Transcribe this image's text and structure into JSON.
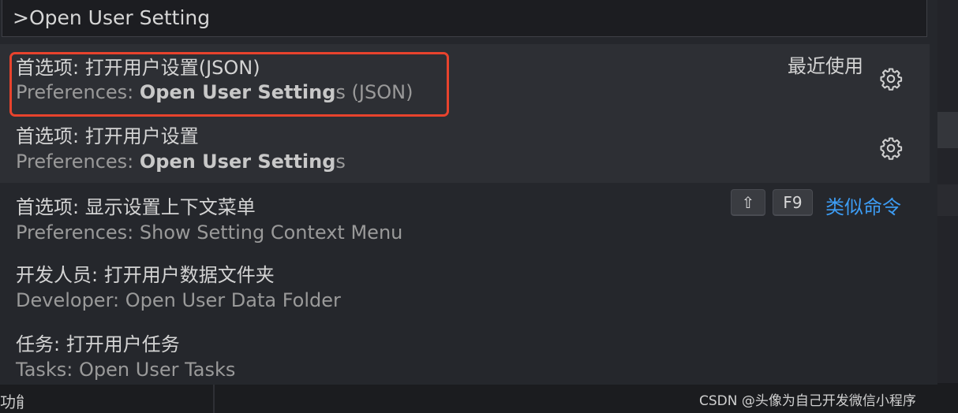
{
  "input": {
    "value": ">Open User Setting"
  },
  "results": [
    {
      "title": "首选项: 打开用户设置(JSON)",
      "detail_prefix": "Preferences: ",
      "detail_bold": "Open User Setting",
      "detail_suffix": "s (JSON)",
      "badge": "最近使用",
      "action_icon": "gear-icon"
    },
    {
      "title": "首选项: 打开用户设置",
      "detail_prefix": "Preferences: ",
      "detail_bold": "Open User Setting",
      "detail_suffix": "s",
      "action_icon": "gear-icon"
    },
    {
      "title": "首选项: 显示设置上下文菜单",
      "detail": "Preferences: Show Setting Context Menu",
      "keys": [
        "⇧",
        "F9"
      ],
      "similar_label": "类似命令"
    },
    {
      "title": "开发人员: 打开用户数据文件夹",
      "detail": "Developer: Open User Data Folder"
    },
    {
      "title": "任务: 打开用户任务",
      "detail": "Tasks: Open User Tasks"
    }
  ],
  "background": {
    "fragment": "功能"
  },
  "watermark": "CSDN @头像为自己开发微信小程序",
  "colors": {
    "highlight": "#e8432d",
    "link": "#3d9cf3",
    "selected_row": "#2d2f34"
  }
}
